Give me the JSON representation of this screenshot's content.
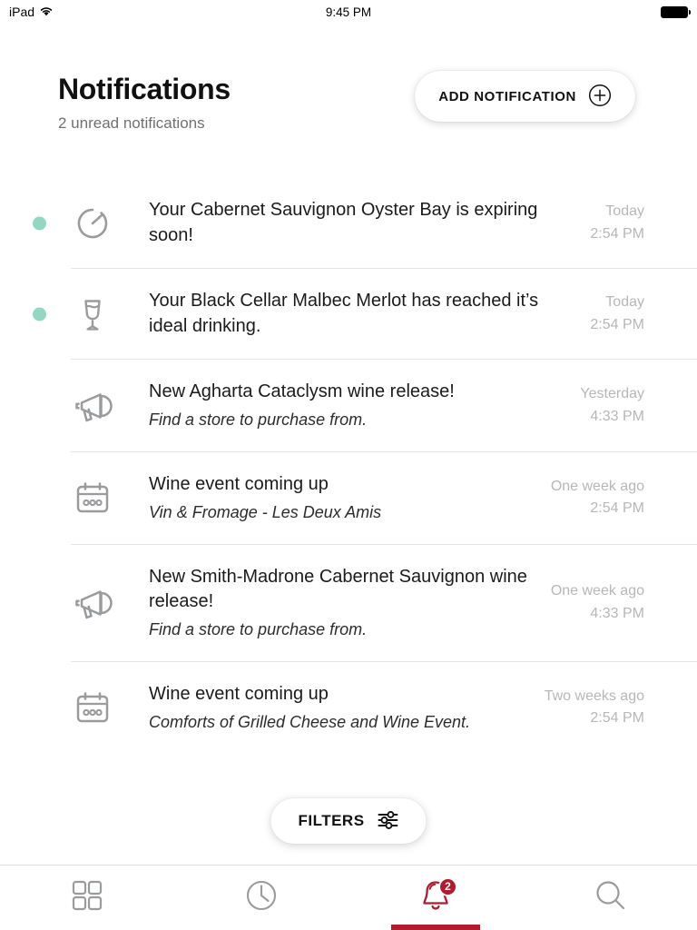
{
  "status_bar": {
    "device": "iPad",
    "wifi_icon": "wifi-icon",
    "time": "9:45 PM",
    "battery_icon": "battery-full-icon"
  },
  "header": {
    "title": "Notifications",
    "subtitle": "2 unread notifications",
    "add_button": {
      "label": "ADD NOTIFICATION",
      "icon": "plus-circle-icon"
    }
  },
  "notifications": [
    {
      "icon": "expiring-clock-icon",
      "unread": true,
      "title": "Your Cabernet Sauvignon Oyster Bay is expiring soon!",
      "subtitle": "",
      "date": "Today",
      "time": "2:54 PM"
    },
    {
      "icon": "wine-glass-icon",
      "unread": true,
      "title": "Your Black Cellar Malbec Merlot has reached it’s ideal drinking.",
      "subtitle": "",
      "date": "Today",
      "time": "2:54 PM"
    },
    {
      "icon": "megaphone-icon",
      "unread": false,
      "title": "New Agharta Cataclysm wine release!",
      "subtitle": "Find a store to purchase from.",
      "date": "Yesterday",
      "time": "4:33 PM"
    },
    {
      "icon": "calendar-icon",
      "unread": false,
      "title": "Wine event coming up",
      "subtitle": "Vin & Fromage - Les Deux Amis",
      "date": "One week ago",
      "time": "2:54 PM"
    },
    {
      "icon": "megaphone-icon",
      "unread": false,
      "title": "New Smith-Madrone Cabernet Sauvignon wine release!",
      "subtitle": "Find a store to purchase from.",
      "date": "One week ago",
      "time": "4:33 PM"
    },
    {
      "icon": "calendar-icon",
      "unread": false,
      "title": "Wine event coming up",
      "subtitle": "Comforts of Grilled Cheese and Wine Event.",
      "date": "Two weeks ago",
      "time": "2:54 PM"
    }
  ],
  "filters_button": {
    "label": "FILTERS",
    "icon": "sliders-icon"
  },
  "tab_bar": {
    "items": [
      {
        "name": "grid",
        "icon": "grid-icon",
        "active": false,
        "badge": ""
      },
      {
        "name": "history",
        "icon": "clock-icon",
        "active": false,
        "badge": ""
      },
      {
        "name": "notifications",
        "icon": "bell-icon",
        "active": true,
        "badge": "2"
      },
      {
        "name": "search",
        "icon": "search-icon",
        "active": false,
        "badge": ""
      }
    ]
  },
  "colors": {
    "accent_red": "#b01b2e",
    "unread_teal": "#93d7c2",
    "icon_gray": "#9a9b9d",
    "divider": "#e3e4e6"
  }
}
